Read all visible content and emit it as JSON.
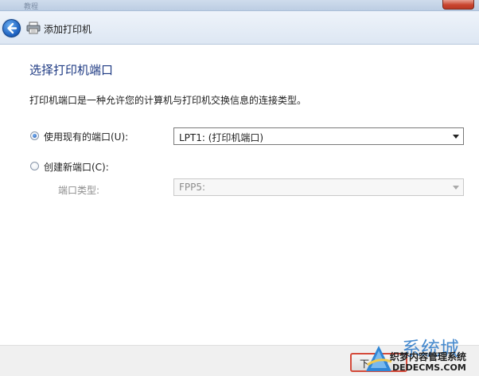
{
  "window": {
    "faded_title": "教程",
    "nav_title": "添加打印机"
  },
  "page": {
    "heading": "选择打印机端口",
    "description": "打印机端口是一种允许您的计算机与打印机交换信息的连接类型。"
  },
  "options": {
    "use_existing": {
      "label": "使用现有的端口(U):",
      "selected": true,
      "value": "LPT1: (打印机端口)"
    },
    "create_new": {
      "label": "创建新端口(C):",
      "selected": false,
      "type_label": "端口类型:",
      "type_value": "FPP5:"
    }
  },
  "footer": {
    "next_label": "下一步"
  },
  "watermark": {
    "big": "系统城",
    "mid": "织梦内容管理系统",
    "small": "DEDECMS.COM"
  },
  "colors": {
    "heading": "#1e3a83",
    "accent_border": "#d44a3a"
  },
  "icons": {
    "back": "back-arrow-icon",
    "printer": "printer-icon",
    "dropdown": "chevron-down-icon"
  }
}
